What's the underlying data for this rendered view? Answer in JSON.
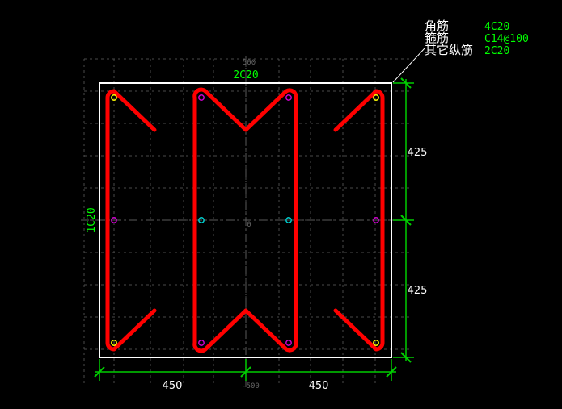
{
  "legend": {
    "rows": [
      {
        "label": "角筋",
        "value": "4C20"
      },
      {
        "label": "箍筋",
        "value": "C14@100"
      },
      {
        "label": "其它纵筋",
        "value": "2C20"
      }
    ]
  },
  "top_bar_label": "2C20",
  "side_bar_label": "1C20",
  "dimensions": {
    "right_upper": "425",
    "right_lower": "425",
    "bottom_left": "450",
    "bottom_right": "450",
    "grid_top_label": "500",
    "grid_bottom_label": "-500",
    "grid_center_label": "0"
  },
  "colors": {
    "background": "#000000",
    "outline": "#ffffff",
    "rebar": "#ff0000",
    "dimension_line": "#00cc00",
    "label_green": "#00ff00",
    "corner_bar": "#ffff00",
    "middle_bar": "#00cccc",
    "side_bar": "#cc00cc",
    "grid": "#555555"
  }
}
